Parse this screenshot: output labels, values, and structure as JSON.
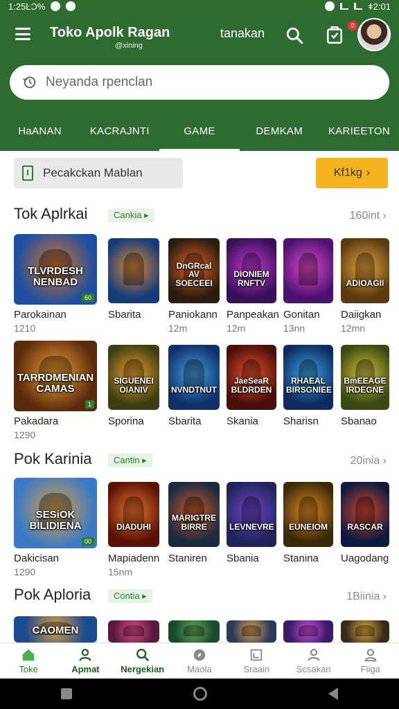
{
  "status": {
    "left": "1:25ĿƆ%",
    "right": "ǂ2:01"
  },
  "header": {
    "title": "Toko Apolk Ragan",
    "subtitle": "@xining",
    "action": "tanakan",
    "cart_badge": "0"
  },
  "search": {
    "placeholder": "Neyanda rpenclan"
  },
  "tabs": [
    "HaANAN",
    "KACRAJNTI",
    "GAME",
    "DEMKAM",
    "KARIEETON"
  ],
  "promo": {
    "left_label": "Pecakckan Mablan",
    "right_label": "Kf1kg"
  },
  "sections": [
    {
      "title": "Tok Aplrkai",
      "tag": "Cankia",
      "more": "160int",
      "rows": [
        [
          {
            "name": "Parokainan",
            "meta": "1210",
            "art": "TLVRDESH NENBAD",
            "badge": "60",
            "colors": [
              "#1e4fa0",
              "#d9742a"
            ]
          },
          {
            "name": "Sbarita",
            "meta": "",
            "art": "",
            "badge": "",
            "colors": [
              "#153c7a",
              "#e08a30"
            ]
          },
          {
            "name": "Paniokann",
            "meta": "12m",
            "art": "DnGRcal AV SOECEEI",
            "badge": "",
            "colors": [
              "#2b1d0e",
              "#e3632a"
            ]
          },
          {
            "name": "Panpeakan",
            "meta": "12m",
            "art": "DIONIEM RNFTV",
            "badge": "",
            "colors": [
              "#3a0f5a",
              "#c43bd0"
            ]
          },
          {
            "name": "Gonitan",
            "meta": "13nn",
            "art": "",
            "badge": "",
            "colors": [
              "#4b1270",
              "#e04ac8"
            ]
          },
          {
            "name": "Daiigkan",
            "meta": "12mn",
            "art": "ADIOAGII",
            "badge": "",
            "colors": [
              "#5a3a10",
              "#e9a640"
            ]
          }
        ],
        [
          {
            "name": "Pakadara",
            "meta": "1290",
            "art": "TARRDMENIAN CAMAS",
            "badge": "1",
            "colors": [
              "#5a2a0c",
              "#f2a13a"
            ]
          },
          {
            "name": "Sporina",
            "meta": "",
            "art": "SIGUENEI OIANIV",
            "badge": "",
            "colors": [
              "#3d3e12",
              "#f0a030"
            ]
          },
          {
            "name": "Sbarita",
            "meta": "",
            "art": "NVNDTNUT",
            "badge": "",
            "colors": [
              "#10306a",
              "#43a0e0"
            ]
          },
          {
            "name": "Skania",
            "meta": "",
            "art": "JaeSeaR BLDRDEN",
            "badge": "",
            "colors": [
              "#4a0f0a",
              "#e8522a"
            ]
          },
          {
            "name": "Sharisn",
            "meta": "",
            "art": "RHAEAL BIRSGNIEE",
            "badge": "",
            "colors": [
              "#0f2a60",
              "#3aa8e8"
            ]
          },
          {
            "name": "Sbanao",
            "meta": "",
            "art": "BmEEAGE IRDEGNE",
            "badge": "",
            "colors": [
              "#3a4a10",
              "#d8c040"
            ]
          }
        ]
      ]
    },
    {
      "title": "Pok Karinia",
      "tag": "Cantin",
      "more": "20inia",
      "rows": [
        [
          {
            "name": "Dakicisan",
            "meta": "1290",
            "art": "SESiOK BILIDIENA",
            "badge": "00",
            "colors": [
              "#3a79c8",
              "#d9a040"
            ]
          },
          {
            "name": "Mapiadenn",
            "meta": "15nm",
            "art": "DIADUHI",
            "badge": "",
            "colors": [
              "#5a1208",
              "#f0782a"
            ]
          },
          {
            "name": "Staniren",
            "meta": "",
            "art": "MARIGTRE BIRRE",
            "badge": "",
            "colors": [
              "#1a2a40",
              "#c85a2a"
            ]
          },
          {
            "name": "Sbania",
            "meta": "",
            "art": "LEVNEVRE",
            "badge": "",
            "colors": [
              "#20245a",
              "#7048d0"
            ]
          },
          {
            "name": "Stanina",
            "meta": "",
            "art": "EUNEIOM",
            "badge": "",
            "colors": [
              "#3a2a0a",
              "#e88a20"
            ]
          },
          {
            "name": "Uagodang",
            "meta": "",
            "art": "RASCAR",
            "badge": "",
            "colors": [
              "#0f1a40",
              "#d8482a"
            ]
          }
        ]
      ]
    },
    {
      "title": "Pok Aploria",
      "tag": "Contia",
      "more": "1Biinia",
      "rows": [
        [
          {
            "name": "",
            "meta": "",
            "art": "CAOMEN",
            "badge": "",
            "colors": [
              "#1a4a90",
              "#e0a040"
            ]
          },
          {
            "name": "",
            "meta": "",
            "art": "",
            "badge": "",
            "colors": [
              "#5a1a40",
              "#e0508a"
            ]
          },
          {
            "name": "",
            "meta": "",
            "art": "",
            "badge": "",
            "colors": [
              "#1a4a2a",
              "#60b060"
            ]
          },
          {
            "name": "",
            "meta": "",
            "art": "",
            "badge": "",
            "colors": [
              "#2a3a5a",
              "#e0a050"
            ]
          },
          {
            "name": "",
            "meta": "",
            "art": "",
            "badge": "",
            "colors": [
              "#3a1a6a",
              "#d050e0"
            ]
          },
          {
            "name": "",
            "meta": "",
            "art": "",
            "badge": "",
            "colors": [
              "#3a2a1a",
              "#e0b040"
            ]
          }
        ]
      ]
    }
  ],
  "bottom_nav": [
    {
      "label": "Toke",
      "icon": "home-icon",
      "state": "active"
    },
    {
      "label": "Apmat",
      "icon": "person-icon",
      "state": "bold"
    },
    {
      "label": "Nergekian",
      "icon": "search-icon",
      "state": "bold"
    },
    {
      "label": "Maola",
      "icon": "compass-icon",
      "state": ""
    },
    {
      "label": "Sraain",
      "icon": "image-icon",
      "state": ""
    },
    {
      "label": "Scsakan",
      "icon": "person-icon",
      "state": ""
    },
    {
      "label": "Fiiga",
      "icon": "account-icon",
      "state": ""
    }
  ],
  "colors": {
    "brand": "#2e6b30",
    "accent": "#f5b41f",
    "tag_bg": "#e6f3e6"
  }
}
